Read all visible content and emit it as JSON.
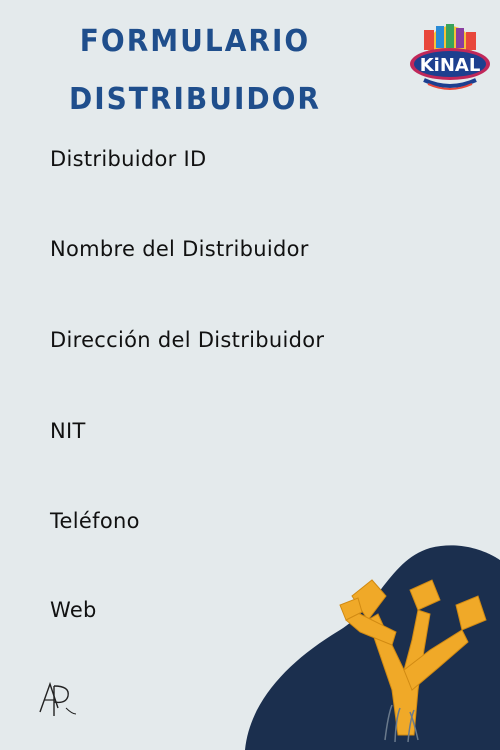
{
  "header": {
    "title_line1": "FORMULARIO",
    "title_line2": "DISTRIBUIDOR",
    "logo_text": "KiNAL"
  },
  "form": {
    "fields": [
      {
        "label": "Distribuidor ID"
      },
      {
        "label": "Nombre del Distribuidor"
      },
      {
        "label": "Dirección del Distribuidor"
      },
      {
        "label": "NIT"
      },
      {
        "label": "Teléfono"
      },
      {
        "label": "Web"
      }
    ]
  },
  "colors": {
    "background": "#e4eaec",
    "title": "#1f4e8c",
    "blob": "#1b2f4e",
    "coral": "#f0a928"
  },
  "icons": {
    "logo": "kinal-logo",
    "decoration": "coral-decoration",
    "signature": "ap-monogram"
  }
}
